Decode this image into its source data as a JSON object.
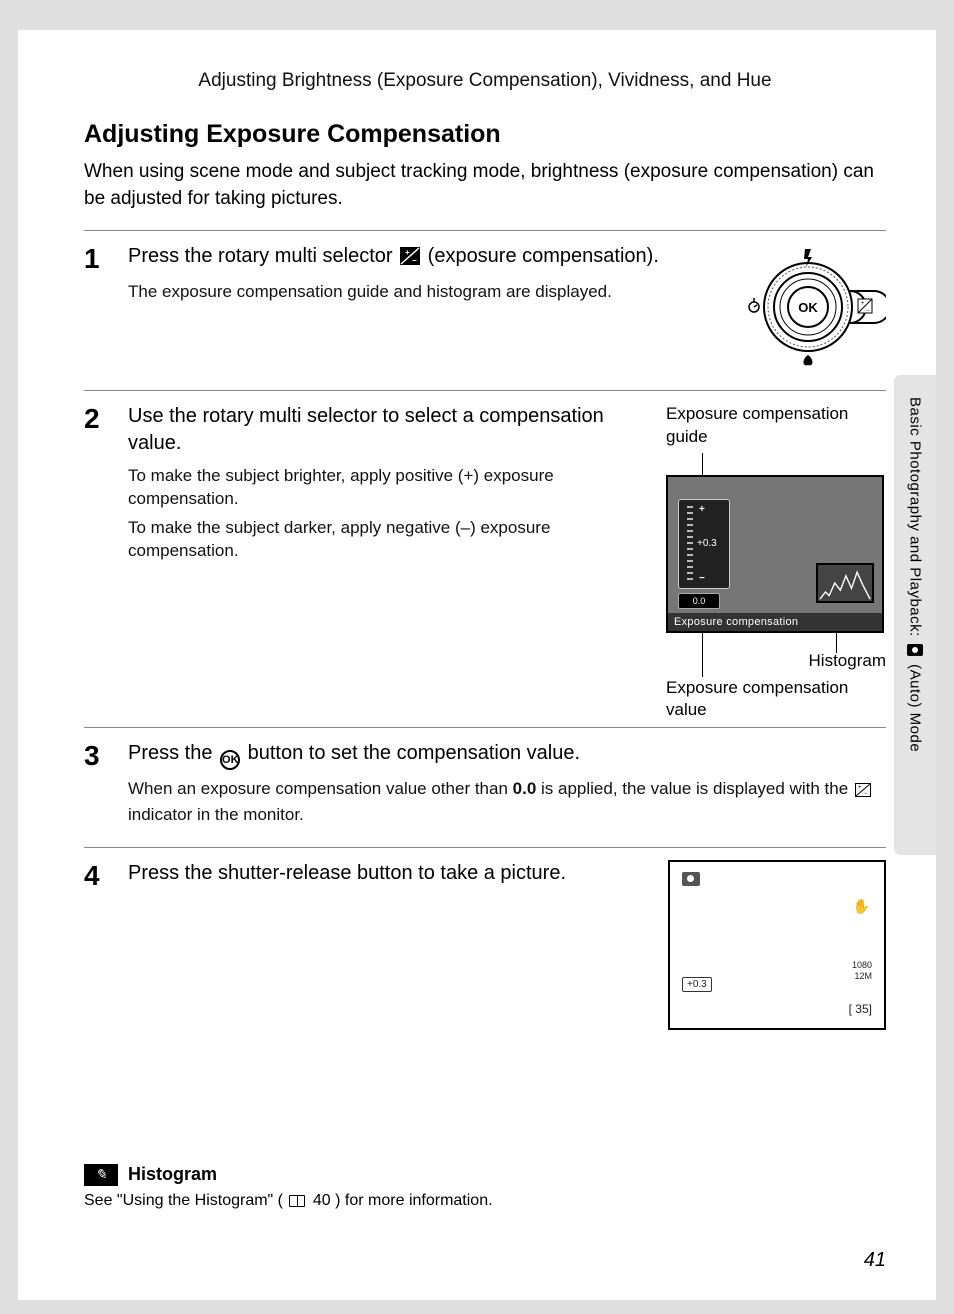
{
  "breadcrumb": "Adjusting Brightness (Exposure Compensation), Vividness, and Hue",
  "heading": "Adjusting Exposure Compensation",
  "intro": "When using scene mode and subject tracking mode, brightness (exposure compensation) can be adjusted for taking pictures.",
  "sidetab": {
    "before": "Basic Photography and Playback: ",
    "after": " (Auto) Mode"
  },
  "steps": {
    "s1": {
      "num": "1",
      "lead_a": "Press the rotary multi selector ",
      "lead_b": " (exposure compensation).",
      "sub": "The exposure compensation guide and histogram are displayed.",
      "selector_ok": "OK"
    },
    "s2": {
      "num": "2",
      "lead": "Use the rotary multi selector to select a compensation value.",
      "sub1": "To make the subject brighter, apply positive (+) exposure compensation.",
      "sub2": "To make the subject darker, apply negative (–) exposure compensation.",
      "label_guide": "Exposure compensation guide",
      "screen_title": "Exposure compensation",
      "gauge_value": "+0.3",
      "exp_badge": "0.0",
      "callout_histogram": "Histogram",
      "callout_value": "Exposure compensation value"
    },
    "s3": {
      "num": "3",
      "lead_a": "Press the ",
      "lead_b": " button to set the compensation value.",
      "ok_label": "OK",
      "sub_a": "When an exposure compensation value other than ",
      "sub_bold": "0.0",
      "sub_b": " is applied, the value is displayed with the ",
      "sub_c": " indicator in the monitor."
    },
    "s4": {
      "num": "4",
      "lead": "Press the shutter-release button to take a picture.",
      "exp_chip": "+0.3",
      "res1": "1080",
      "res2": "12M",
      "shots": "[   35]"
    }
  },
  "note": {
    "title": "Histogram",
    "body_a": "See \"Using the Histogram\" (",
    "body_ref": "40",
    "body_b": ") for more information."
  },
  "page_number": "41"
}
